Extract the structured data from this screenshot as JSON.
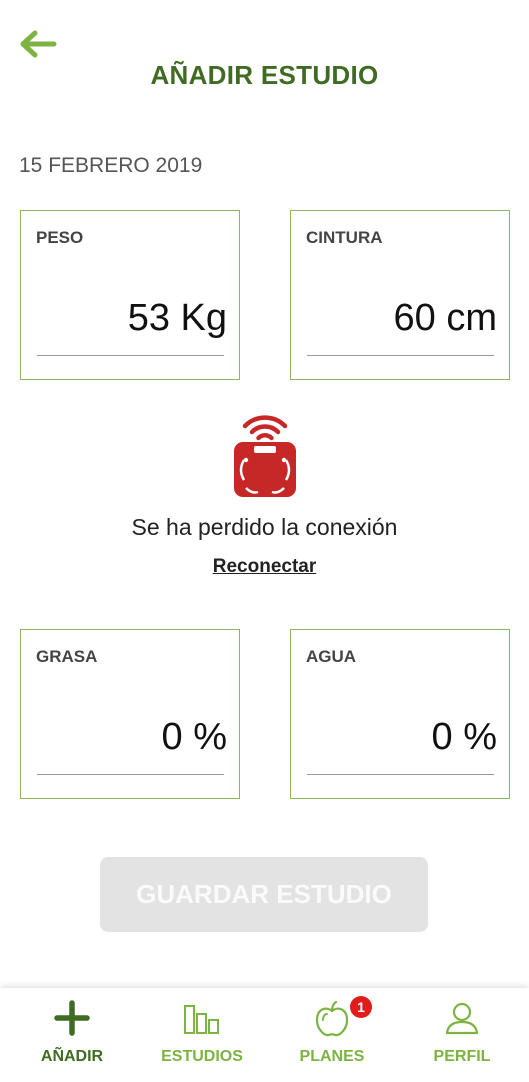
{
  "header": {
    "title": "AÑADIR ESTUDIO",
    "back_icon": "arrow-left-icon"
  },
  "date": "15 FEBRERO 2019",
  "measurements": {
    "peso": {
      "label": "PESO",
      "value": "53 Kg"
    },
    "cintura": {
      "label": "CINTURA",
      "value": "60 cm"
    },
    "grasa": {
      "label": "GRASA",
      "value": "0 %"
    },
    "agua": {
      "label": "AGUA",
      "value": "0 %"
    }
  },
  "connection": {
    "icon": "wireless-scale-icon",
    "message": "Se ha perdido la conexión",
    "reconnect_label": "Reconectar"
  },
  "save_button": {
    "label": "GUARDAR ESTUDIO",
    "enabled": false
  },
  "tabbar": {
    "tabs": [
      {
        "label": "AÑADIR",
        "icon": "plus-icon",
        "active": true
      },
      {
        "label": "ESTUDIOS",
        "icon": "bar-chart-icon",
        "active": false
      },
      {
        "label": "PLANES",
        "icon": "apple-icon",
        "active": false,
        "badge": "1"
      },
      {
        "label": "PERFIL",
        "icon": "user-icon",
        "active": false
      }
    ]
  },
  "colors": {
    "primary_dark": "#3f6b22",
    "primary_light": "#7cb342",
    "card_border": "#8ab85a",
    "scale_red": "#c62828",
    "badge_red": "#e21b1b",
    "disabled_button": "#e3e3e3"
  }
}
